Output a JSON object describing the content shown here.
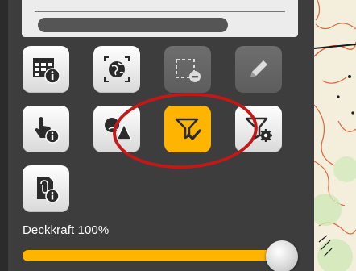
{
  "opacity": {
    "label": "Deckkraft 100%",
    "value_percent": 100
  },
  "tools": [
    {
      "name": "attribute-table-button",
      "icon": "table-info-icon",
      "state": "enabled"
    },
    {
      "name": "zoom-to-extent-button",
      "icon": "globe-frame-icon",
      "state": "enabled"
    },
    {
      "name": "remove-selection-button",
      "icon": "dashed-rect-minus-icon",
      "state": "disabled"
    },
    {
      "name": "edit-button",
      "icon": "pencil-icon",
      "state": "disabled"
    },
    {
      "name": "feature-info-button",
      "icon": "pointer-info-icon",
      "state": "enabled"
    },
    {
      "name": "layer-style-button",
      "icon": "shapes-icon",
      "state": "enabled"
    },
    {
      "name": "filter-apply-button",
      "icon": "filter-check-icon",
      "state": "active"
    },
    {
      "name": "filter-settings-button",
      "icon": "filter-gear-icon",
      "state": "enabled"
    },
    {
      "name": "metadata-button",
      "icon": "document-info-icon",
      "state": "enabled"
    }
  ],
  "colors": {
    "panel": "#3d3d3d",
    "accent": "#ffb400",
    "highlight_ring": "#c21818",
    "map_bg": "#f4eedd",
    "contour": "#e0663a"
  }
}
